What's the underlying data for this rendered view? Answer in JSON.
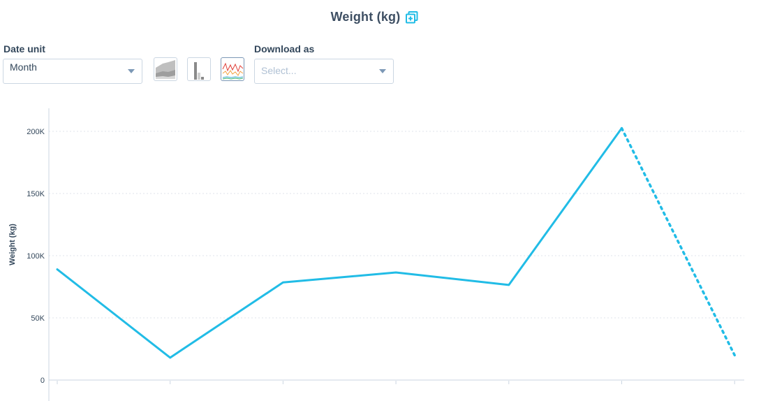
{
  "header": {
    "title": "Weight (kg)",
    "expand_icon": "expand-icon"
  },
  "controls": {
    "date_unit_label": "Date unit",
    "date_unit_value": "Month",
    "chart_types": [
      {
        "name": "area-chart-icon",
        "active": false
      },
      {
        "name": "bar-chart-icon",
        "active": false
      },
      {
        "name": "line-chart-icon",
        "active": true
      }
    ],
    "download_label": "Download as",
    "download_placeholder": "Select..."
  },
  "colors": {
    "line": "#21bce6",
    "grid": "#dfe3eb",
    "axis": "#cbd6e2",
    "tick_text": "#33475b"
  },
  "chart_data": {
    "type": "line",
    "ylabel": "Weight (kg)",
    "yticks": [
      0,
      50000,
      100000,
      150000,
      200000
    ],
    "ytick_labels": [
      "0",
      "50K",
      "100K",
      "150K",
      "200K"
    ],
    "ylim": [
      0,
      220000
    ],
    "grid": true,
    "series": [
      {
        "values": [
          89000,
          18000,
          78500,
          86500,
          76500,
          202500,
          20000
        ],
        "projected_from_index": 5
      }
    ]
  }
}
